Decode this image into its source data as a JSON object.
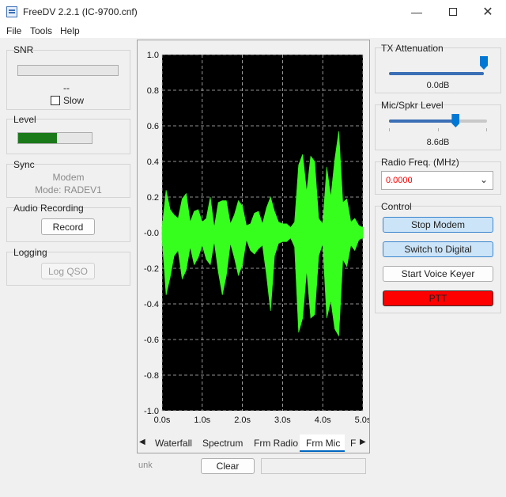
{
  "window": {
    "title": "FreeDV 2.2.1 (IC-9700.cnf)",
    "minimize_icon": "minimize-icon",
    "maximize_icon": "maximize-icon",
    "close_icon": "close-icon"
  },
  "menu": [
    "File",
    "Tools",
    "Help"
  ],
  "left": {
    "snr": {
      "label": "SNR",
      "value": "--",
      "slow_label": "Slow",
      "slow_checked": false
    },
    "level": {
      "label": "Level",
      "level_fraction": 0.53,
      "color": "#1a7a1a"
    },
    "sync": {
      "label": "Sync",
      "line1": "Modem",
      "line2": "Mode: RADEV1"
    },
    "audio": {
      "label": "Audio Recording",
      "record_label": "Record"
    },
    "logging": {
      "label": "Logging",
      "log_label": "Log QSO"
    }
  },
  "plot": {
    "tabs": [
      "Waterfall",
      "Spectrum",
      "Frm Radio",
      "Frm Mic",
      "F"
    ],
    "active_tab": "Frm Mic",
    "bottom_left": "unk",
    "clear_label": "Clear",
    "chart_data": {
      "type": "area",
      "x_ticks": [
        "0.0s",
        "1.0s",
        "2.0s",
        "3.0s",
        "4.0s",
        "5.0s"
      ],
      "y_ticks": [
        "1.0",
        "0.8",
        "0.6",
        "0.4",
        "0.2",
        "-0.0",
        "-0.2",
        "-0.4",
        "-0.6",
        "-0.8",
        "-1.0"
      ],
      "xlim": [
        0,
        5
      ],
      "ylim": [
        -1,
        1
      ],
      "grid": true,
      "background": "#000000",
      "trace_color": "#36ff1e",
      "grid_color": "#bfbfbf",
      "envelope_x": [
        0.0,
        0.1,
        0.2,
        0.3,
        0.4,
        0.5,
        0.6,
        0.7,
        0.8,
        0.9,
        1.0,
        1.1,
        1.2,
        1.3,
        1.4,
        1.5,
        1.6,
        1.7,
        1.8,
        1.9,
        2.0,
        2.1,
        2.2,
        2.3,
        2.4,
        2.5,
        2.6,
        2.7,
        2.8,
        2.9,
        3.0,
        3.1,
        3.2,
        3.3,
        3.4,
        3.5,
        3.6,
        3.7,
        3.8,
        3.9,
        4.0,
        4.1,
        4.2,
        4.3,
        4.4,
        4.5,
        4.6,
        4.7,
        4.8,
        4.9,
        5.0
      ],
      "envelope_top": [
        0.03,
        0.24,
        0.13,
        0.1,
        0.08,
        0.19,
        0.22,
        0.06,
        0.12,
        0.13,
        0.06,
        0.08,
        0.2,
        0.03,
        0.17,
        0.18,
        0.18,
        0.05,
        0.1,
        0.18,
        0.15,
        0.04,
        0.05,
        0.11,
        0.12,
        0.05,
        0.14,
        0.2,
        0.12,
        0.06,
        0.05,
        0.05,
        0.03,
        0.06,
        0.38,
        0.44,
        0.23,
        0.43,
        0.4,
        0.08,
        0.05,
        0.37,
        0.2,
        0.41,
        0.57,
        0.17,
        0.19,
        0.06,
        0.08,
        0.04,
        0.03
      ],
      "envelope_bottom": [
        -0.03,
        -0.35,
        -0.25,
        -0.13,
        -0.1,
        -0.26,
        -0.21,
        -0.08,
        -0.18,
        -0.14,
        -0.07,
        -0.15,
        -0.18,
        -0.05,
        -0.22,
        -0.35,
        -0.24,
        -0.06,
        -0.14,
        -0.24,
        -0.18,
        -0.04,
        -0.1,
        -0.12,
        -0.09,
        -0.07,
        -0.24,
        -0.44,
        -0.13,
        -0.06,
        -0.05,
        -0.05,
        -0.03,
        -0.08,
        -0.56,
        -0.48,
        -0.21,
        -0.48,
        -0.46,
        -0.13,
        -0.06,
        -0.48,
        -0.38,
        -0.54,
        -0.58,
        -0.15,
        -0.19,
        -0.07,
        -0.1,
        -0.04,
        -0.03
      ]
    }
  },
  "right": {
    "tx": {
      "label": "TX Attenuation",
      "value": "0.0dB",
      "fraction": 1.0
    },
    "mic": {
      "label": "Mic/Spkr Level",
      "value": "8.6dB",
      "fraction": 0.68
    },
    "freq": {
      "label": "Radio Freq. (MHz)",
      "value": "0.0000",
      "value_color": "#ff0000"
    },
    "control": {
      "label": "Control",
      "stop_label": "Stop Modem",
      "digital_label": "Switch to Digital",
      "voice_label": "Start Voice Keyer",
      "ptt_label": "PTT",
      "ptt_color": "#ff0000"
    }
  }
}
